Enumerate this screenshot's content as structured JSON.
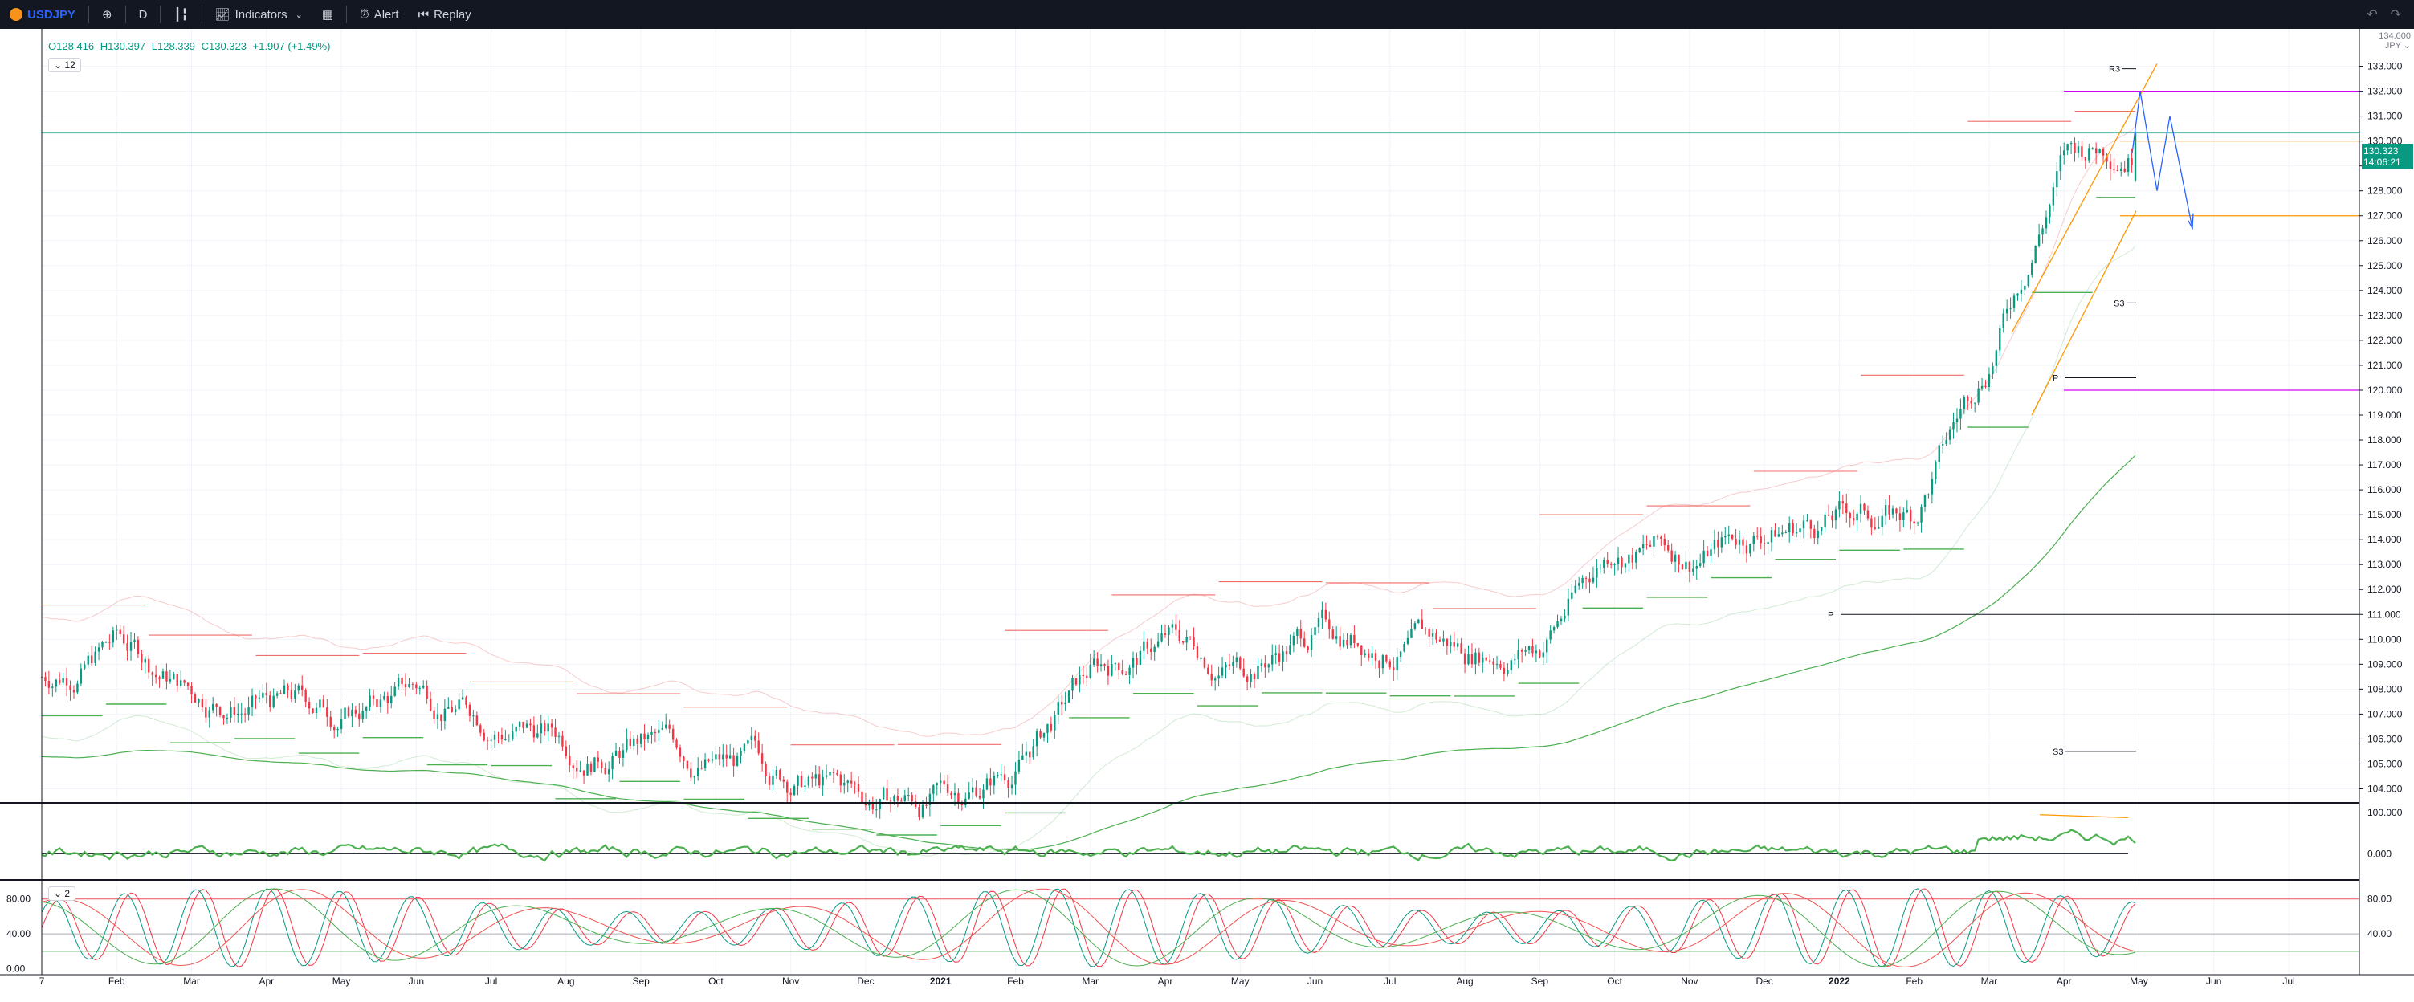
{
  "toolbar": {
    "symbol": "USDJPY",
    "interval": "D",
    "indicators_label": "Indicators",
    "alert_label": "Alert",
    "replay_label": "Replay"
  },
  "legend": {
    "open": "O128.416",
    "high": "H130.397",
    "low": "L128.339",
    "close": "C130.323",
    "change": "+1.907 (+1.49%)",
    "indicator_count": "12",
    "pane_count": "2"
  },
  "price_axis": {
    "currency": "JPY",
    "top_label": "134.000",
    "labels": [
      "133.000",
      "132.000",
      "131.000",
      "130.000",
      "129.000",
      "128.000",
      "127.000",
      "126.000",
      "125.000",
      "124.000",
      "123.000",
      "122.000",
      "121.000",
      "120.000",
      "119.000",
      "118.000",
      "117.000",
      "116.000",
      "115.000",
      "114.000",
      "113.000",
      "112.000",
      "111.000",
      "110.000",
      "109.000",
      "108.000",
      "107.000",
      "106.000",
      "105.000",
      "104.000"
    ],
    "last_price": "130.323",
    "countdown": "14:06:21"
  },
  "osc1_axis": [
    "100.000",
    "0.000"
  ],
  "osc2_axis_left": [
    "80.00",
    "40.00",
    "0.00"
  ],
  "osc2_axis_right": [
    "80.00",
    "40.00"
  ],
  "time_axis": [
    "7",
    "Feb",
    "Mar",
    "Apr",
    "May",
    "Jun",
    "Jul",
    "Aug",
    "Sep",
    "Oct",
    "Nov",
    "Dec",
    "2021",
    "Feb",
    "Mar",
    "Apr",
    "May",
    "Jun",
    "Jul",
    "Aug",
    "Sep",
    "Oct",
    "Nov",
    "Dec",
    "2022",
    "Feb",
    "Mar",
    "Apr",
    "May",
    "Jun",
    "Jul"
  ],
  "pivots": {
    "r3": "R3",
    "s3_upper": "S3",
    "p_upper": "P",
    "p_lower": "P",
    "s3_lower": "S3"
  },
  "colors": {
    "up": "#089981",
    "down": "#f23645",
    "green_band": "#4caf50",
    "red_band": "#ef5350",
    "orange": "#ff9800",
    "violet": "#d500f9",
    "blue": "#2962ff"
  },
  "chart_data": {
    "type": "candlestick",
    "symbol": "USDJPY",
    "interval": "D",
    "ylim": [
      103.5,
      134.5
    ],
    "x_range": [
      "2020-01",
      "2022-07"
    ],
    "approx_close_path": [
      {
        "t": "2020-01",
        "y": 108.5
      },
      {
        "t": "2020-02",
        "y": 110.0
      },
      {
        "t": "2020-03",
        "y": 108.0
      },
      {
        "t": "2020-04",
        "y": 107.5
      },
      {
        "t": "2020-05",
        "y": 107.0
      },
      {
        "t": "2020-06",
        "y": 108.0
      },
      {
        "t": "2020-07",
        "y": 107.0
      },
      {
        "t": "2020-08",
        "y": 106.0
      },
      {
        "t": "2020-09",
        "y": 106.0
      },
      {
        "t": "2020-10",
        "y": 105.0
      },
      {
        "t": "2020-11",
        "y": 104.5
      },
      {
        "t": "2020-12",
        "y": 103.5
      },
      {
        "t": "2021-01",
        "y": 103.5
      },
      {
        "t": "2021-02",
        "y": 105.0
      },
      {
        "t": "2021-03",
        "y": 108.5
      },
      {
        "t": "2021-04",
        "y": 110.0
      },
      {
        "t": "2021-05",
        "y": 109.0
      },
      {
        "t": "2021-06",
        "y": 110.5
      },
      {
        "t": "2021-07",
        "y": 110.0
      },
      {
        "t": "2021-08",
        "y": 109.5
      },
      {
        "t": "2021-09",
        "y": 110.0
      },
      {
        "t": "2021-10",
        "y": 114.0
      },
      {
        "t": "2021-11",
        "y": 113.5
      },
      {
        "t": "2021-12",
        "y": 114.5
      },
      {
        "t": "2022-01",
        "y": 115.0
      },
      {
        "t": "2022-02",
        "y": 115.0
      },
      {
        "t": "2022-03",
        "y": 121.5
      },
      {
        "t": "2022-04",
        "y": 129.5
      },
      {
        "t": "2022-05",
        "y": 130.3
      }
    ],
    "horizontal_levels": [
      {
        "name": "last",
        "y": 130.323
      },
      {
        "name": "orange-1",
        "y": 130.0
      },
      {
        "name": "orange-2",
        "y": 127.0
      },
      {
        "name": "violet-1",
        "y": 132.0
      },
      {
        "name": "violet-2",
        "y": 120.0
      },
      {
        "name": "R3",
        "y": 132.9
      },
      {
        "name": "S3-upper",
        "y": 123.5
      },
      {
        "name": "P-upper",
        "y": 120.5
      },
      {
        "name": "P-lower",
        "y": 111.0
      },
      {
        "name": "S3-lower",
        "y": 105.5
      }
    ],
    "osc1_ylim": [
      -60,
      120
    ],
    "osc2_ylim": [
      -5,
      100
    ]
  }
}
